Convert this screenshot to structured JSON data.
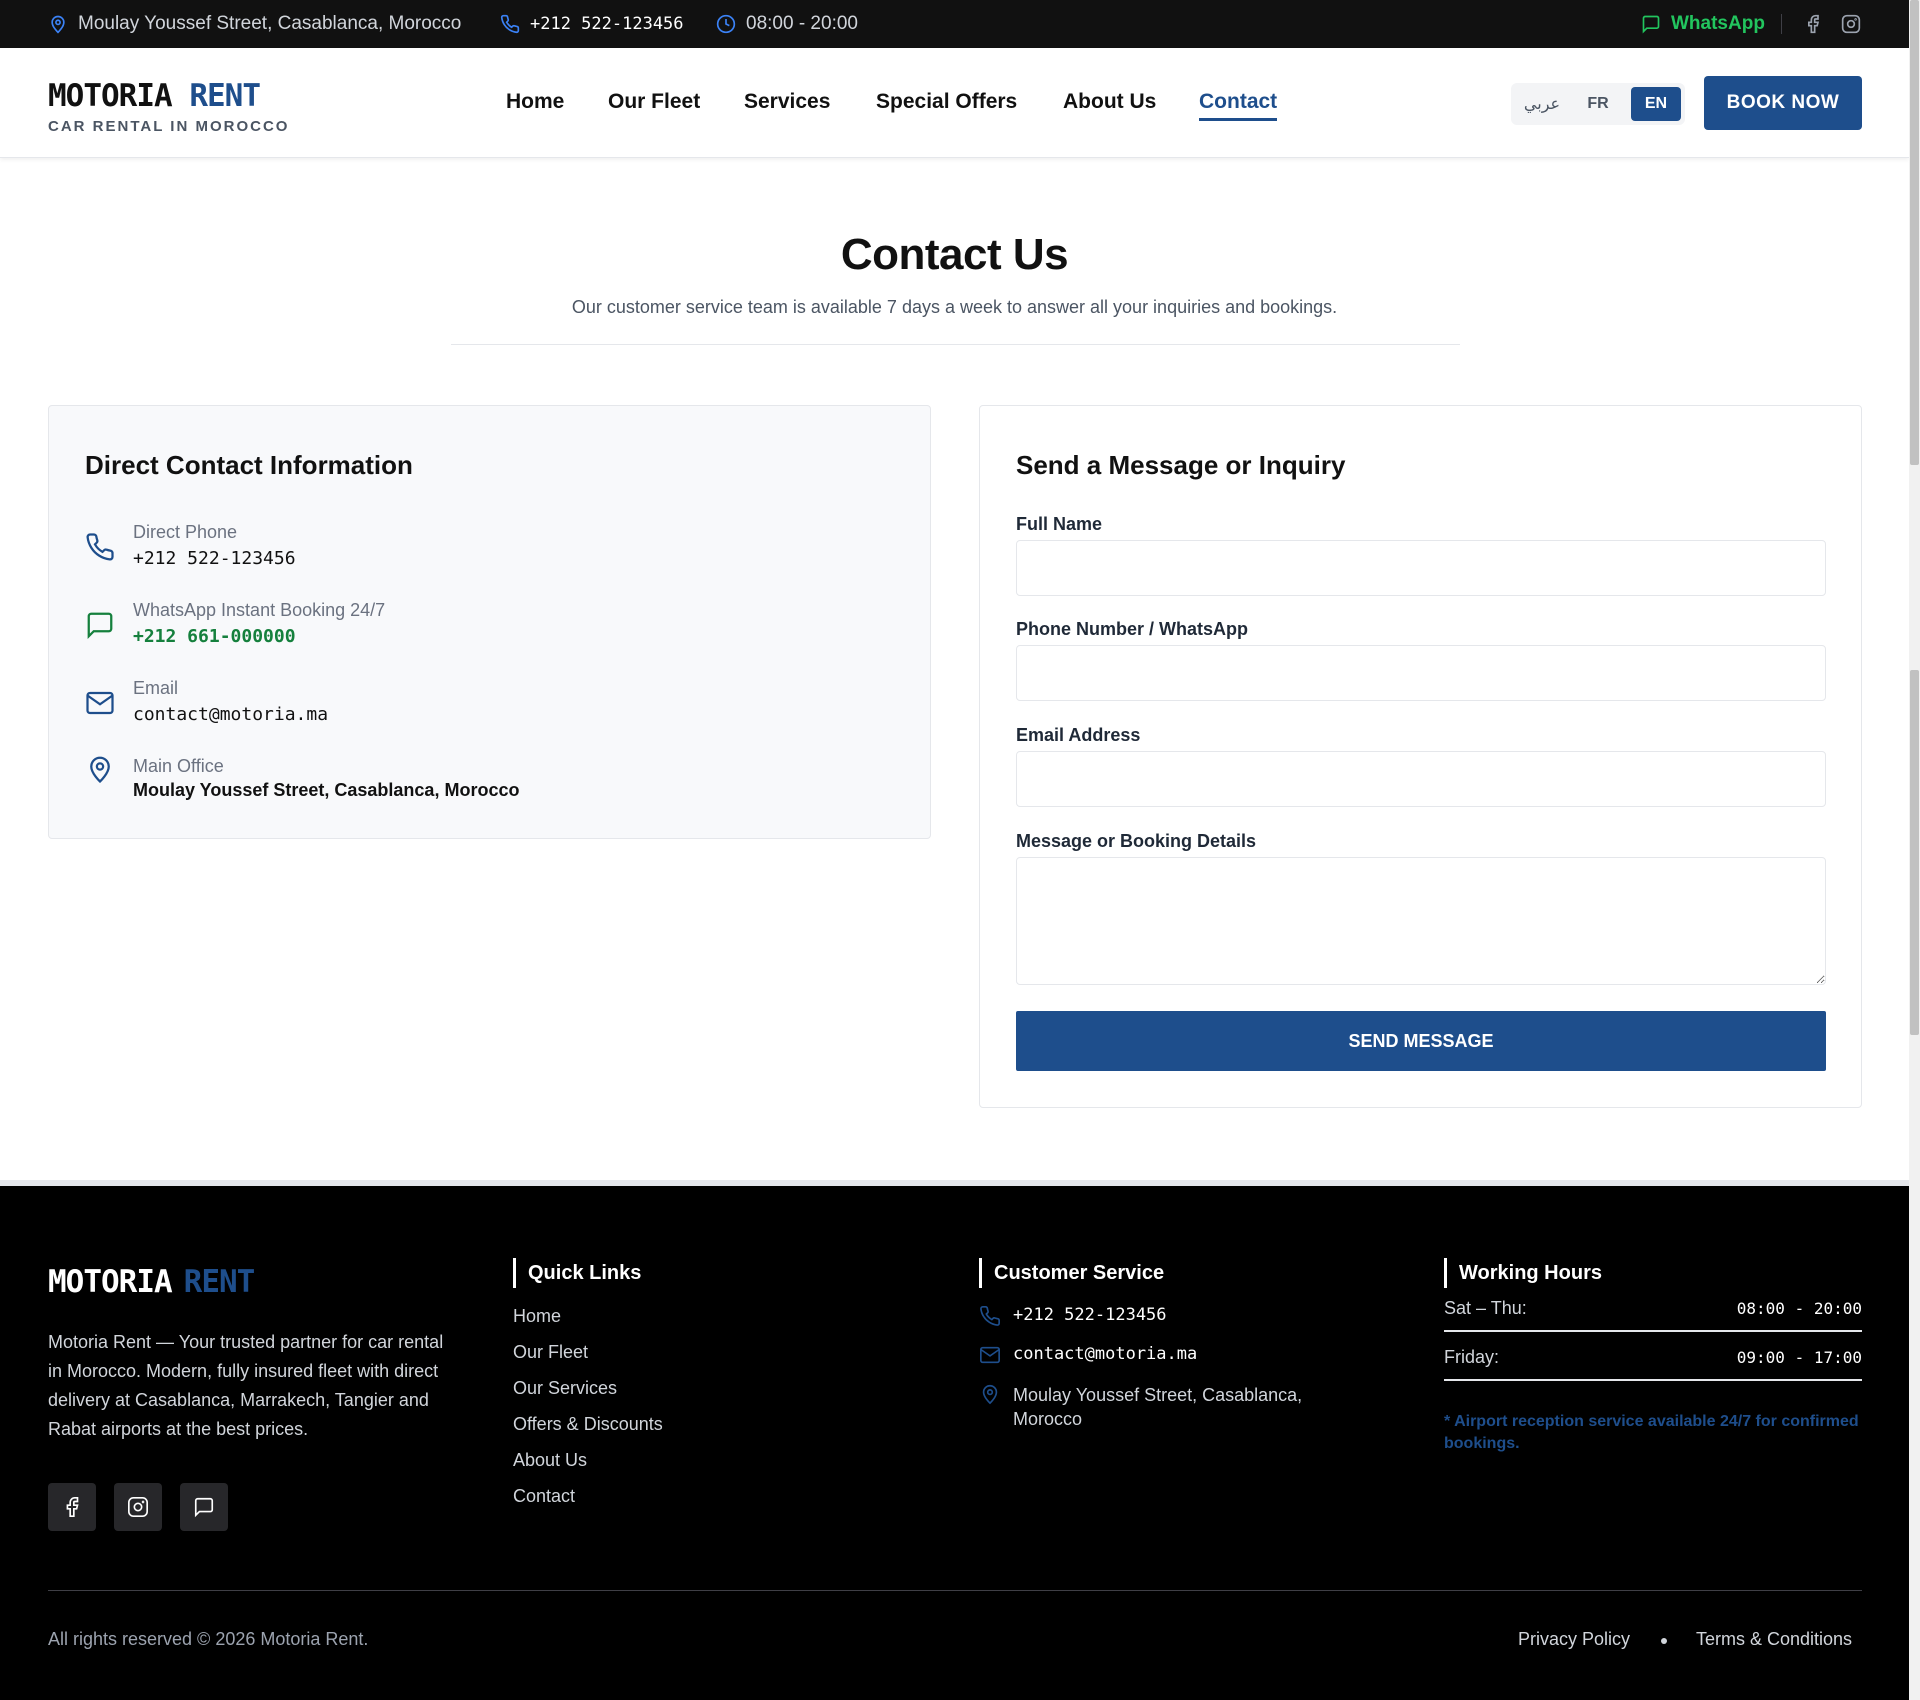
{
  "topbar": {
    "address": "Moulay Youssef Street, Casablanca, Morocco",
    "phone": "+212 522-123456",
    "hours": "08:00 - 20:00",
    "whatsapp": "WhatsApp"
  },
  "header": {
    "logo_main": "MOTORIA",
    "logo_accent": "RENT",
    "logo_tagline": "CAR RENTAL IN MOROCCO",
    "nav": [
      "Home",
      "Our Fleet",
      "Services",
      "Special Offers",
      "About Us",
      "Contact"
    ],
    "active_nav": "Contact",
    "languages": [
      "عربي",
      "FR",
      "EN"
    ],
    "active_language": "EN",
    "book_label": "BOOK NOW"
  },
  "hero": {
    "title": "Contact Us",
    "subtitle": "Our customer service team is available 7 days a week to answer all your inquiries and bookings."
  },
  "contact_info": {
    "title": "Direct Contact Information",
    "items": [
      {
        "label": "Direct Phone",
        "value": "+212 522-123456",
        "icon": "phone-icon"
      },
      {
        "label": "WhatsApp Instant Booking 24/7",
        "value": "+212 661-000000",
        "icon": "chat-icon"
      },
      {
        "label": "Email",
        "value": "contact@motoria.ma",
        "icon": "mail-icon"
      },
      {
        "label": "Main Office",
        "value": "Moulay Youssef Street, Casablanca, Morocco",
        "icon": "location-pin-icon"
      }
    ]
  },
  "form": {
    "title": "Send a Message or Inquiry",
    "fields": [
      {
        "label": "Full Name",
        "value": ""
      },
      {
        "label": "Phone Number / WhatsApp",
        "value": ""
      },
      {
        "label": "Email Address",
        "value": ""
      },
      {
        "label": "Message or Booking Details",
        "value": ""
      }
    ],
    "submit_label": "SEND MESSAGE"
  },
  "footer": {
    "logo_main": "MOTORIA",
    "logo_accent": "RENT",
    "about": "Motoria Rent — Your trusted partner for car rental in Morocco. Modern, fully insured fleet with direct delivery at Casablanca, Marrakech, Tangier and Rabat airports at the best prices.",
    "quick_links_title": "Quick Links",
    "quick_links": [
      "Home",
      "Our Fleet",
      "Our Services",
      "Offers & Discounts",
      "About Us",
      "Contact"
    ],
    "customer_service_title": "Customer Service",
    "customer_service": {
      "phone": "+212 522-123456",
      "email": "contact@motoria.ma",
      "address": "Moulay Youssef Street, Casablanca, Morocco"
    },
    "working_hours_title": "Working Hours",
    "hours": [
      {
        "days": "Sat – Thu:",
        "time": "08:00 - 20:00"
      },
      {
        "days": "Friday:",
        "time": "09:00 - 17:00"
      }
    ],
    "note": "* Airport reception service available 24/7 for confirmed bookings.",
    "copyright": "All rights reserved © 2026 Motoria Rent.",
    "privacy": "Privacy Policy",
    "terms": "Terms & Conditions"
  },
  "colors": {
    "brand_blue": "#1e4e8c",
    "whatsapp_green": "#22c55e",
    "footer_bg": "#000000",
    "topbar_bg": "#111111"
  }
}
